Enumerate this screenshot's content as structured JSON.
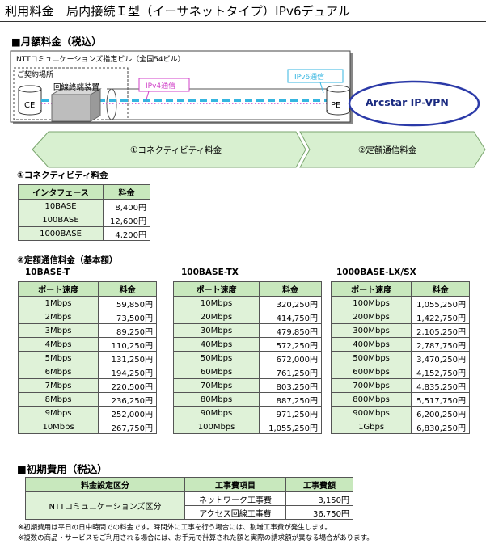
{
  "title": "利用料金　局内接続Ｉ型（イーサネットタイプ）IPv6デュアル",
  "monthly": {
    "heading": "■月額料金（税込）",
    "diagram": {
      "building_label": "NTTコミュニケーションズ指定ビル（全国54ビル）",
      "premises_label": "ご契約場所",
      "device_label": "回線終端装置",
      "ce": "CE",
      "pe": "PE",
      "ipv4": "IPv4通信",
      "ipv6": "IPv6通信",
      "vpn": "Arcstar IP-VPN",
      "arrow1": "①コネクティビティ料金",
      "arrow2": "②定額通信料金"
    },
    "connectivity": {
      "heading": "①コネクティビティ料金",
      "headers": [
        "インタフェース",
        "料金"
      ],
      "rows": [
        [
          "10BASE",
          "8,400円"
        ],
        [
          "100BASE",
          "12,600円"
        ],
        [
          "1000BASE",
          "4,200円"
        ]
      ]
    },
    "flat": {
      "heading": "②定額通信料金（基本額）",
      "tables": [
        {
          "label": "10BASE-T",
          "headers": [
            "ポート速度",
            "料金"
          ],
          "rows": [
            [
              "1Mbps",
              "59,850円"
            ],
            [
              "2Mbps",
              "73,500円"
            ],
            [
              "3Mbps",
              "89,250円"
            ],
            [
              "4Mbps",
              "110,250円"
            ],
            [
              "5Mbps",
              "131,250円"
            ],
            [
              "6Mbps",
              "194,250円"
            ],
            [
              "7Mbps",
              "220,500円"
            ],
            [
              "8Mbps",
              "236,250円"
            ],
            [
              "9Mbps",
              "252,000円"
            ],
            [
              "10Mbps",
              "267,750円"
            ]
          ]
        },
        {
          "label": "100BASE-TX",
          "headers": [
            "ポート速度",
            "料金"
          ],
          "rows": [
            [
              "10Mbps",
              "320,250円"
            ],
            [
              "20Mbps",
              "414,750円"
            ],
            [
              "30Mbps",
              "479,850円"
            ],
            [
              "40Mbps",
              "572,250円"
            ],
            [
              "50Mbps",
              "672,000円"
            ],
            [
              "60Mbps",
              "761,250円"
            ],
            [
              "70Mbps",
              "803,250円"
            ],
            [
              "80Mbps",
              "887,250円"
            ],
            [
              "90Mbps",
              "971,250円"
            ],
            [
              "100Mbps",
              "1,055,250円"
            ]
          ]
        },
        {
          "label": "1000BASE-LX/SX",
          "headers": [
            "ポート速度",
            "料金"
          ],
          "rows": [
            [
              "100Mbps",
              "1,055,250円"
            ],
            [
              "200Mbps",
              "1,422,750円"
            ],
            [
              "300Mbps",
              "2,105,250円"
            ],
            [
              "400Mbps",
              "2,787,750円"
            ],
            [
              "500Mbps",
              "3,470,250円"
            ],
            [
              "600Mbps",
              "4,152,750円"
            ],
            [
              "700Mbps",
              "4,835,250円"
            ],
            [
              "800Mbps",
              "5,517,750円"
            ],
            [
              "900Mbps",
              "6,200,250円"
            ],
            [
              "1Gbps",
              "6,830,250円"
            ]
          ]
        }
      ]
    }
  },
  "initial": {
    "heading": "■初期費用（税込）",
    "headers": [
      "料金設定区分",
      "工事費項目",
      "工事費額"
    ],
    "group": "NTTコミュニケーションズ区分",
    "rows": [
      [
        "ネットワーク工事費",
        "3,150円"
      ],
      [
        "アクセス回線工事費",
        "36,750円"
      ]
    ],
    "notes": [
      "※初期費用は平日の日中時間での料金です。時間外に工事を行う場合には、割増工事費が発生します。",
      "※複数の商品・サービスをご利用される場合には、お手元で計算された額と実際の請求額が異なる場合があります。"
    ]
  },
  "colors": {
    "header": "#c8e8bd",
    "cell": "#dff2d8",
    "arrow": "#d8f0d0",
    "vpn_border": "#2b3aa8",
    "vpn_text": "#1a2a80",
    "ipv6": "#35b5e0",
    "ipv4": "#d040c8"
  }
}
